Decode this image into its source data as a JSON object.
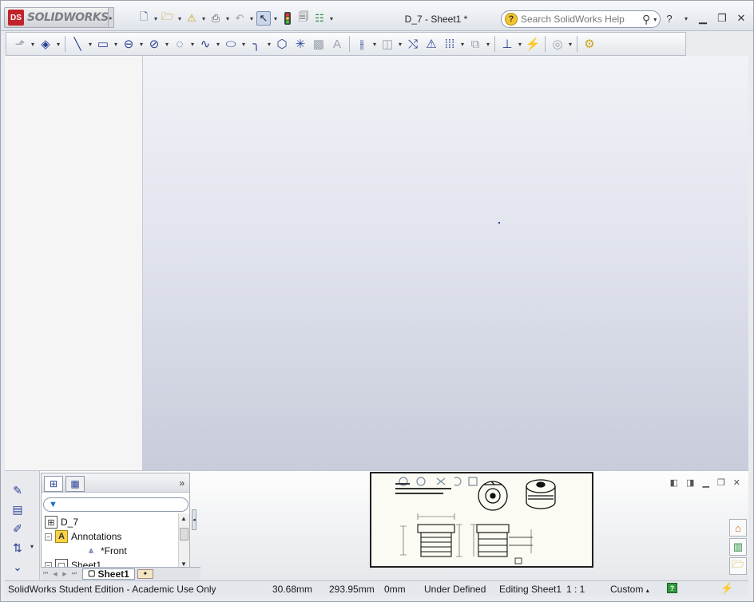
{
  "app": {
    "logo_text": "SOLIDWORKS",
    "doc_title": "D_7 - Sheet1 *"
  },
  "help_search": {
    "placeholder": "Search SolidWorks Help"
  },
  "quick_access": [
    {
      "name": "new-document-icon",
      "glyph": "🗋"
    },
    {
      "name": "open-folder-icon",
      "glyph": "📂"
    },
    {
      "name": "save-warning-icon",
      "glyph": "⚠"
    },
    {
      "name": "print-icon",
      "glyph": "🖶"
    },
    {
      "name": "undo-icon",
      "glyph": "↶"
    },
    {
      "name": "select-pointer-icon",
      "glyph": "↖"
    },
    {
      "name": "rebuild-traffic-light-icon",
      "glyph": "🚦"
    },
    {
      "name": "file-properties-icon",
      "glyph": "🗂"
    },
    {
      "name": "options-icon",
      "glyph": "☰"
    }
  ],
  "sketch_toolbar": [
    "smart-dimension-icon",
    "line-icon",
    "rectangle-icon",
    "slot-icon",
    "circle-icon",
    "arc-icon",
    "spline-icon",
    "ellipse-icon",
    "fillet-icon",
    "polygon-icon",
    "point-icon",
    "hatch-icon",
    "text-icon",
    "mirror-icon",
    "offset-icon",
    "convert-entities-icon",
    "trim-icon",
    "linear-pattern-icon",
    "add-relation-icon",
    "display-relations-icon",
    "repair-sketch-icon",
    "quick-snaps-icon",
    "rapid-sketch-icon"
  ],
  "feature_tree": {
    "root": "D_7",
    "annotations": "Annotations",
    "front_view": "*Front",
    "sheet": "Sheet1"
  },
  "sheet_tab": "Sheet1",
  "status": {
    "edition": "SolidWorks Student Edition - Academic Use Only",
    "x": "30.68mm",
    "y": "293.95mm",
    "z": "0mm",
    "definition": "Under Defined",
    "editing": "Editing Sheet1",
    "scale": "1 : 1",
    "units": "Custom"
  },
  "colors": {
    "accent_blue": "#2a3f94",
    "logo_red": "#c3222b",
    "status_green": "#2f9a3c"
  }
}
